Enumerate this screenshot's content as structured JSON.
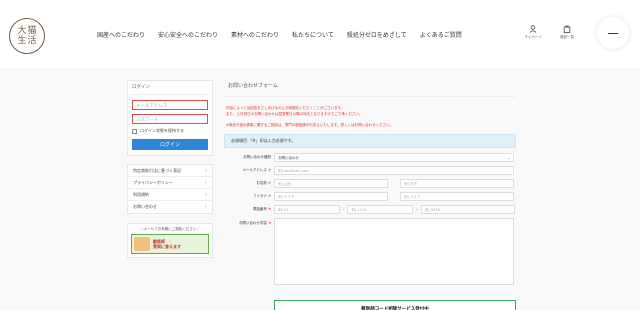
{
  "header": {
    "logo_chars": [
      "大",
      "猫",
      "生",
      "活"
    ],
    "nav": [
      "国産へのこだわり",
      "安心安全へのこだわり",
      "素材へのこだわり",
      "私たちについて",
      "殺処分ゼロをめざして",
      "よくあるご質問"
    ],
    "mypage_label": "マイページ",
    "cart_label": "商品一覧"
  },
  "sidebar": {
    "login_title": "ログイン",
    "email_placeholder": "メールアドレス",
    "password_placeholder": "パスワード",
    "remember_label": "ログイン状態を保持する",
    "login_button": "ログイン",
    "menu": [
      "特定商取引法に基づく表記",
      "プライバシーポリシー",
      "利用規約",
      "お問い合わせ"
    ],
    "banner_heading": "＼メールでお気軽にご相談ください／",
    "banner_line1": "獣医師",
    "banner_line2": "質問に答えます"
  },
  "main": {
    "title": "お問い合わせフォーム",
    "notice_lines": [
      "内容によっては回答をさしあげるのにお時間をいただくことがございます。",
      "また、土日祝日のお問い合わせは翌営業日以降の対応となりますのでご了承ください。"
    ],
    "notice2": "※商品や猫の健康に関するご相談は、専門の獣医師がお答えいたします。詳しくはお問い合わせください。",
    "required_note": "必須項目 「※」印は入力必須です。",
    "fields": {
      "type_label": "お問い合わせ種別",
      "type_value": "お問い合わせ",
      "email_label": "メールアドレス",
      "email_placeholder": "例) abc@abc.com",
      "name_label": "お名前",
      "name_last_placeholder": "例) 山田",
      "name_first_placeholder": "例) 花子",
      "kana_label": "フリガナ",
      "kana_last_placeholder": "例) ヤマダ",
      "kana_first_placeholder": "例) ハナコ",
      "phone_label": "電話番号",
      "phone1_placeholder": "例) 03",
      "phone2_placeholder": "例) 1234",
      "phone3_placeholder": "例) 5678",
      "message_label": "お問い合わせ内容"
    },
    "req_mark": "※",
    "dash": "-",
    "cta": "獣医師コード相談サービス受付中"
  },
  "colors": {
    "accent": "#2f86d6",
    "notice": "#e03131",
    "req_bar": "#def0f8",
    "cta_border": "#3aa65a"
  }
}
